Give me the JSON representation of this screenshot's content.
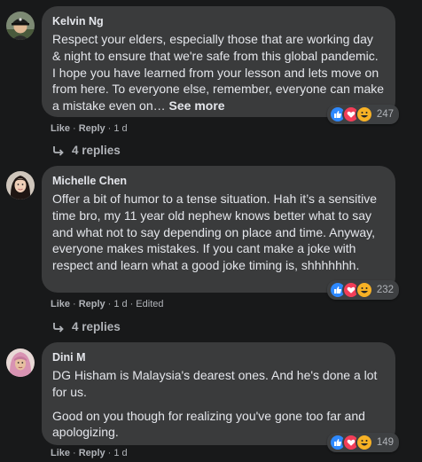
{
  "comments": [
    {
      "author": "Kelvin Ng",
      "text": "Respect your elders, especially those that are working day & night to ensure that we're safe from this global pandemic. I hope you have learned from your lesson and lets move on from here. To everyone else, remember, everyone can make a mistake even on…",
      "see_more": "See more",
      "reaction_count": "247",
      "reaction_icons": [
        "like-icon",
        "love-icon",
        "haha-icon"
      ],
      "like": "Like",
      "reply": "Reply",
      "time": "1 d",
      "replies_label": "4 replies"
    },
    {
      "author": "Michelle Chen",
      "text": "Offer a bit of humor to a tense situation. Hah it’s a sensitive time bro, my 11 year old nephew knows better what to say and what not to say depending on place and time. Anyway, everyone makes mistakes. If you cant make a joke with respect and learn what a good joke timing is, shhhhhhh.",
      "reaction_count": "232",
      "reaction_icons": [
        "like-icon",
        "love-icon",
        "haha-icon"
      ],
      "like": "Like",
      "reply": "Reply",
      "time": "1 d",
      "edited": "Edited",
      "replies_label": "4 replies"
    },
    {
      "author": "Dini M",
      "text": "DG Hisham is Malaysia's dearest ones. And he's done a lot for us.",
      "text2": "Good on you though for realizing you've gone too far and apologizing.",
      "reaction_count": "149",
      "reaction_icons": [
        "like-icon",
        "love-icon",
        "haha-icon"
      ],
      "like": "Like",
      "reply": "Reply",
      "time": "1 d"
    }
  ],
  "separator": "·",
  "colors": {
    "background": "#18191a",
    "bubble": "#3a3b3c",
    "text": "#e4e6eb",
    "secondary": "#b0b3b8",
    "like_blue": "#2e89ff",
    "love_red": "#f33e58",
    "haha_yellow": "#f7b125"
  }
}
